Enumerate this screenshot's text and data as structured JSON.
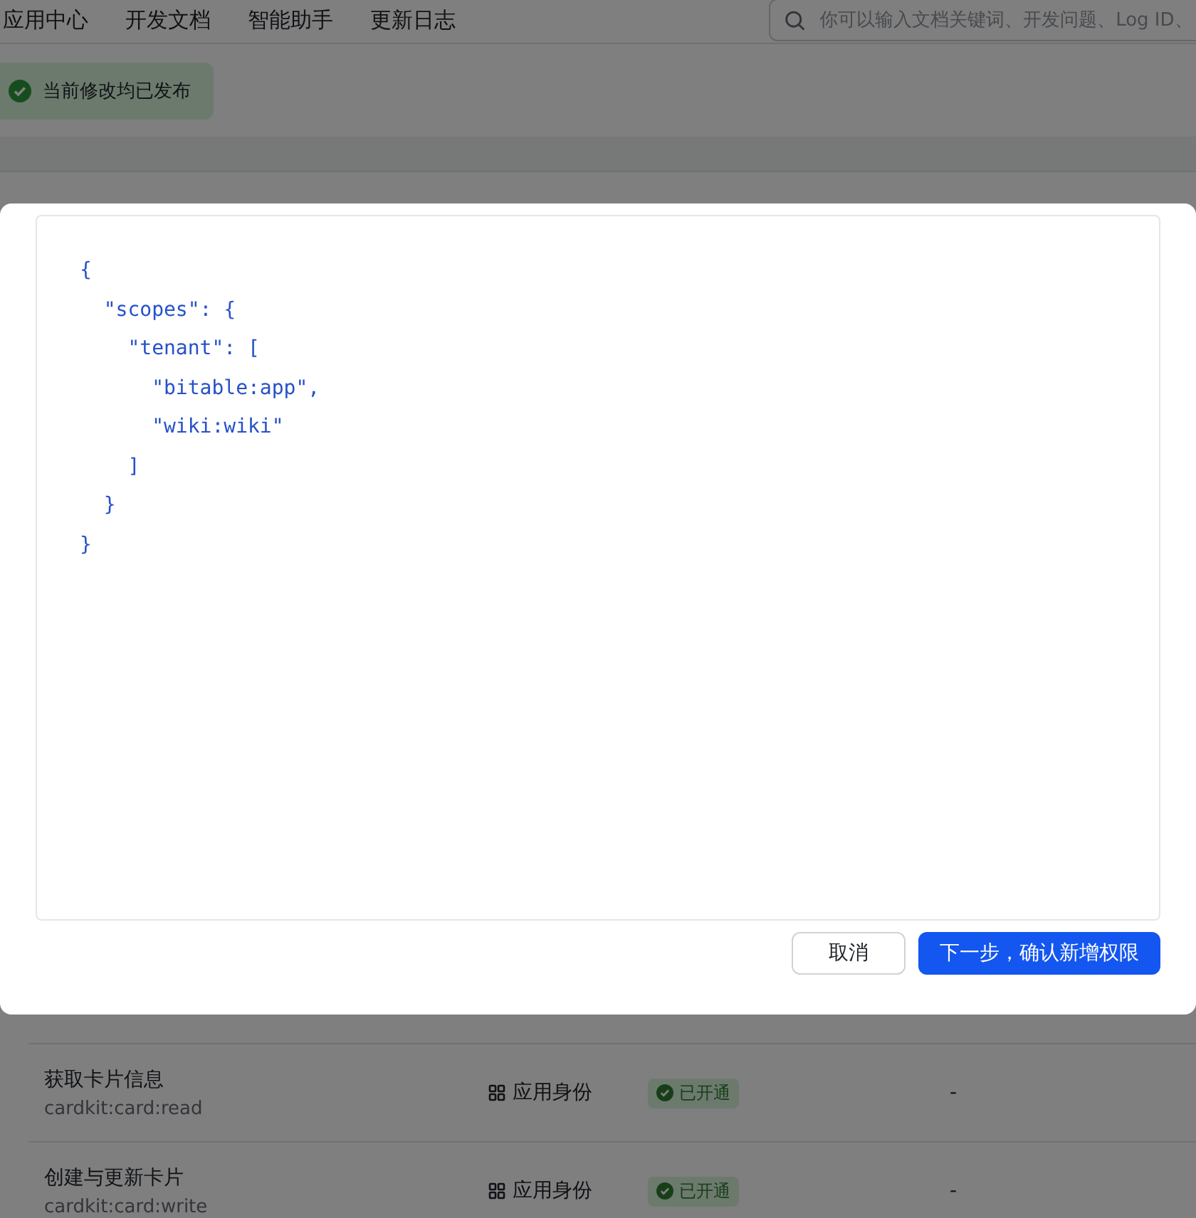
{
  "nav": {
    "items": [
      "应用中心",
      "开发文档",
      "智能助手",
      "更新日志"
    ],
    "search": {
      "placeholder": "你可以输入文档关键词、开发问题、Log ID、"
    }
  },
  "banner": {
    "text": "当前修改均已发布"
  },
  "table": {
    "rows": [
      {
        "name": "获取卡片信息",
        "code": "cardkit:card:read",
        "identity": "应用身份",
        "status": "已开通",
        "column_4": "-"
      },
      {
        "name": "创建与更新卡片",
        "code": "cardkit:card:write",
        "identity": "应用身份",
        "status": "已开通",
        "column_4": "-"
      }
    ]
  },
  "modal": {
    "code_lines": [
      "{",
      "  \"scopes\": {",
      "    \"tenant\": [",
      "      \"bitable:app\",",
      "      \"wiki:wiki\"",
      "    ]",
      "  }",
      "}"
    ],
    "buttons": [
      {
        "label": "取消",
        "kind": "secondary"
      },
      {
        "label": "下一步，确认新增权限",
        "kind": "primary"
      }
    ]
  }
}
